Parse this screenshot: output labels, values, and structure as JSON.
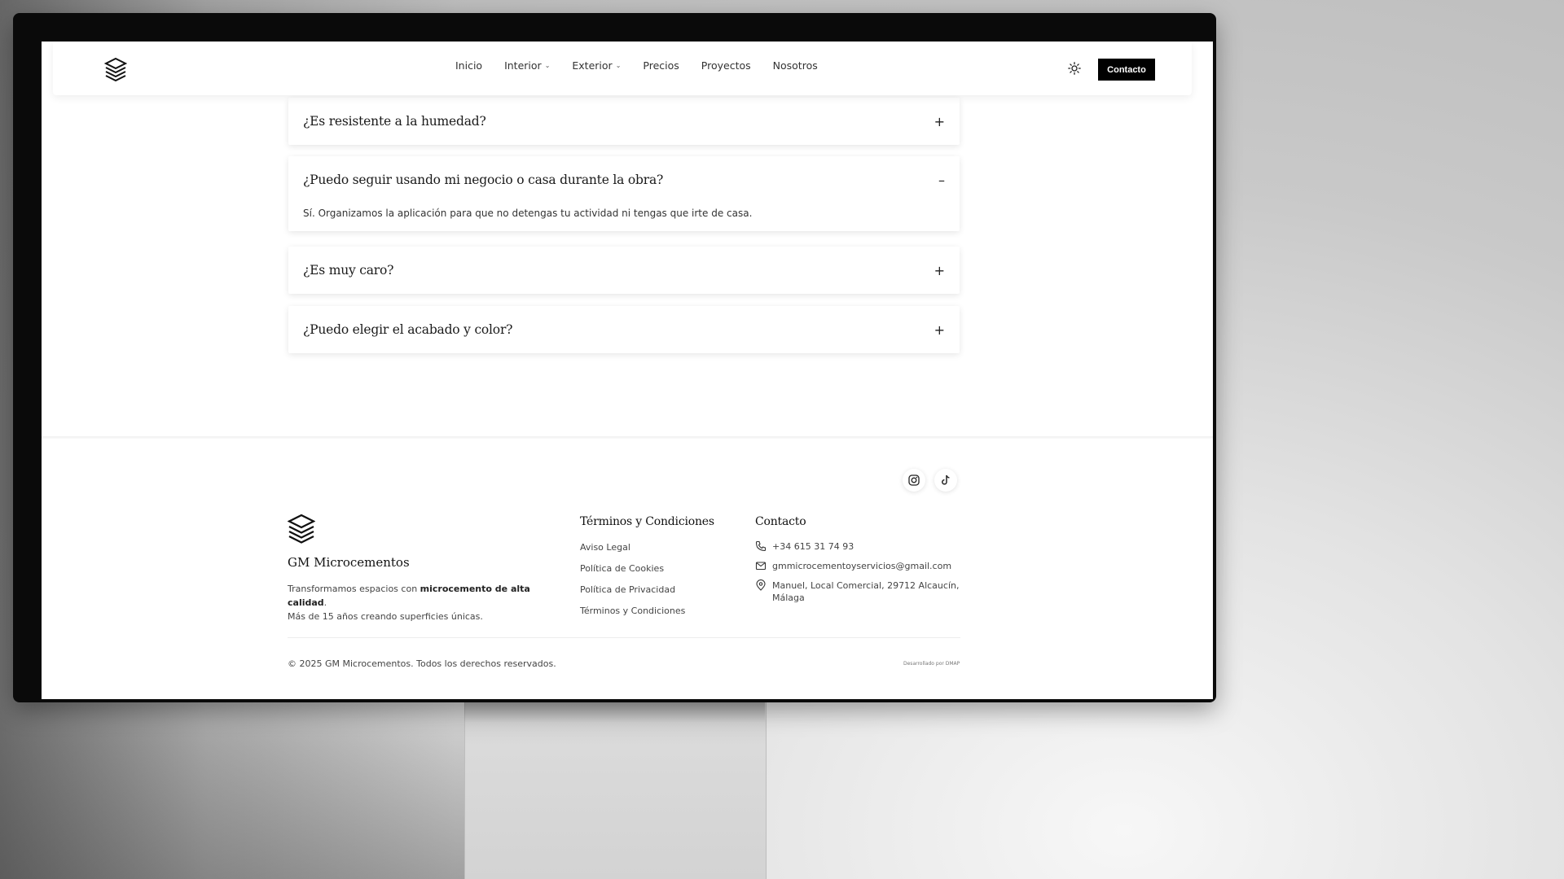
{
  "nav": {
    "items": [
      "Inicio",
      "Interior",
      "Exterior",
      "Precios",
      "Proyectos",
      "Nosotros"
    ],
    "contact_label": "Contacto"
  },
  "faq": [
    {
      "question": "¿Es resistente a la humedad?",
      "toggle": "+",
      "open": false
    },
    {
      "question": "¿Puedo seguir usando mi negocio o casa durante la obra?",
      "toggle": "–",
      "open": true,
      "answer": "Sí. Organizamos la aplicación para que no detengas tu actividad ni tengas que irte de casa."
    },
    {
      "question": "¿Es muy caro?",
      "toggle": "+",
      "open": false
    },
    {
      "question": "¿Puedo elegir el acabado y color?",
      "toggle": "+",
      "open": false
    }
  ],
  "footer": {
    "brand": "GM Microcementos",
    "tagline_pre": "Transformamos espacios con ",
    "tagline_bold": "microcemento de alta calidad",
    "tagline_post": ".",
    "tagline_line2": "Más de 15 años creando superficies únicas.",
    "terms_title": "Términos y Condiciones",
    "terms_links": [
      "Aviso Legal",
      "Política de Cookies",
      "Política de Privacidad",
      "Términos y Condiciones"
    ],
    "contact_title": "Contacto",
    "phone": "+34 615 31 74 93",
    "email": "gmmicrocementoyservicios@gmail.com",
    "address_line1": "Manuel, Local Comercial, 29712 Alcaucín,",
    "address_line2": "Málaga",
    "copyright": "© 2025 GM Microcementos. Todos los derechos reservados.",
    "developer": "Desarrollado por DMAP"
  },
  "icons": {
    "logo": "layers-logo-icon",
    "theme": "sun-icon",
    "social": [
      "instagram-icon",
      "tiktok-icon"
    ],
    "contact": [
      "phone-icon",
      "mail-icon",
      "map-pin-icon"
    ]
  }
}
